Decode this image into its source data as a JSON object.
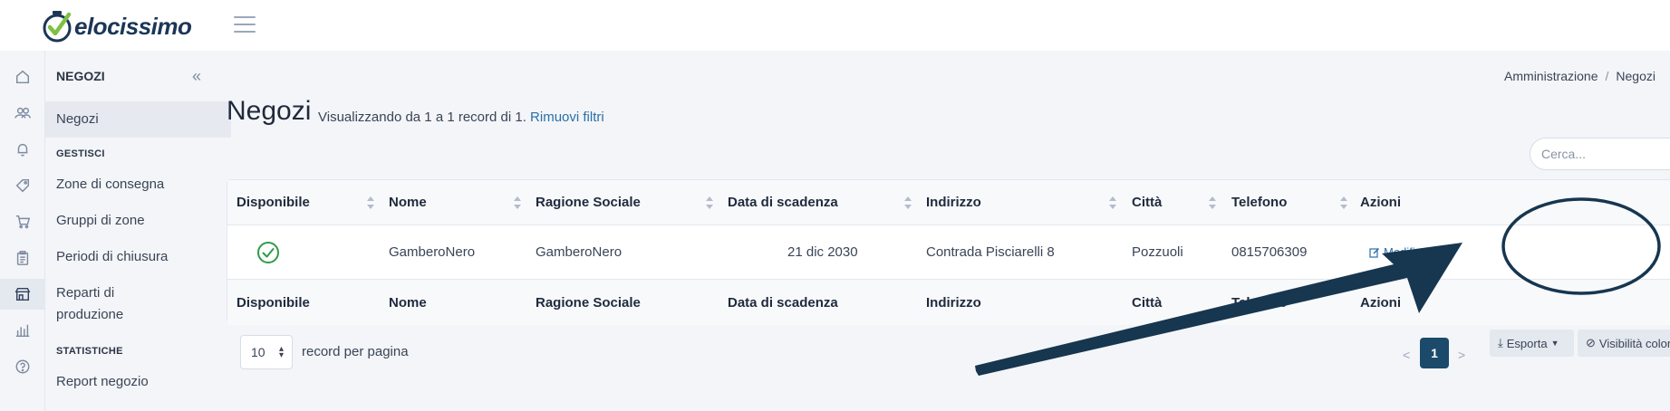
{
  "app": {
    "logo_text": "elocissimo"
  },
  "sidebar": {
    "title": "NEGOZI",
    "active_item": "Negozi",
    "sections": [
      {
        "label": "GESTISCI",
        "items": [
          "Zone di consegna",
          "Gruppi di zone",
          "Periodi di chiusura",
          "Reparti di produzione"
        ]
      },
      {
        "label": "STATISTICHE",
        "items": [
          "Report negozio"
        ]
      }
    ]
  },
  "rail_icons": [
    "home-icon",
    "users-icon",
    "bell-icon",
    "tag-icon",
    "cart-icon",
    "clipboard-icon",
    "store-icon",
    "bar-chart-icon",
    "help-icon"
  ],
  "breadcrumb": {
    "parent": "Amministrazione",
    "sep": "/",
    "current": "Negozi"
  },
  "page": {
    "title": "Negozi",
    "subtitle": "Visualizzando da 1 a 1 record di 1.",
    "clear_filters": "Rimuovi filtri"
  },
  "search": {
    "placeholder": "Cerca..."
  },
  "table": {
    "columns": [
      "Disponibile",
      "Nome",
      "Ragione Sociale",
      "Data di scadenza",
      "Indirizzo",
      "Città",
      "Telefono",
      "Azioni"
    ],
    "rows": [
      {
        "disponibile": true,
        "nome": "GamberoNero",
        "ragione_sociale": "GamberoNero",
        "data_scadenza": "21 dic 2030",
        "indirizzo": "Contrada Pisciarelli 8",
        "citta": "Pozzuoli",
        "telefono": "0815706309",
        "azione": "Modifica"
      }
    ]
  },
  "pagination": {
    "per_page": "10",
    "per_page_label": "record per pagina",
    "prev": "<",
    "current": "1",
    "next": ">"
  },
  "toolbar": {
    "export_label": "Esporta",
    "visibility_label": "Visibilità colonne"
  },
  "colors": {
    "brand": "#1b3657",
    "accent": "#1b4a6b",
    "check": "#2e9b48",
    "annotation": "#17364f"
  }
}
